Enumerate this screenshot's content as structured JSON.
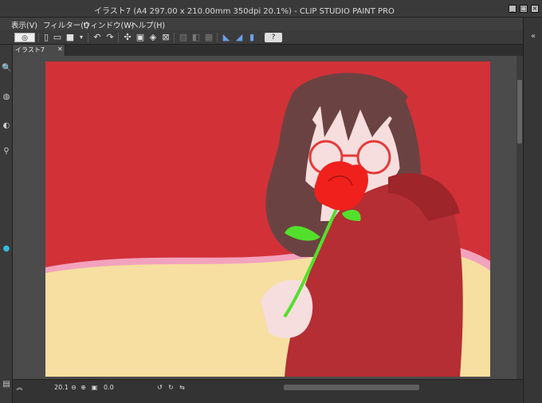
{
  "window": {
    "title": "イラスト7 (A4 297.00 x 210.00mm 350dpi 20.1%)  - CLIP STUDIO PAINT PRO"
  },
  "menu": {
    "items": [
      {
        "label": "表示(V)"
      },
      {
        "label": "フィルター(I)"
      },
      {
        "label": "ウィンドウ(W)"
      },
      {
        "label": "ヘルプ(H)"
      }
    ]
  },
  "tab": {
    "label": "イラスト7"
  },
  "status": {
    "zoom": "20.1",
    "rotation": "0.0"
  },
  "colors": {
    "background": "#d23138",
    "hair": "#6b4242",
    "jacket": "#b42e33",
    "skin": "#f6dede",
    "wave": "#f6dfa0",
    "rose": "#f0201c",
    "stem": "#52e02c"
  }
}
